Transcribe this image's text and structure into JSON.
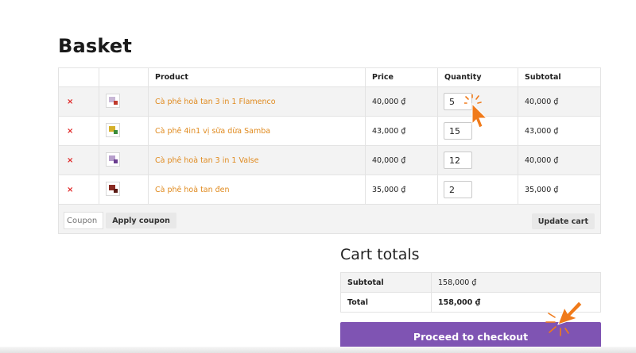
{
  "page": {
    "title": "Basket"
  },
  "table": {
    "headers": {
      "remove": "",
      "thumbnail": "",
      "product": "Product",
      "price": "Price",
      "quantity": "Quantity",
      "subtotal": "Subtotal"
    },
    "rows": [
      {
        "remove": "×",
        "product": "Cà phê hoà tan 3 in 1 Flamenco",
        "price": "40,000 ₫",
        "quantity": "5",
        "subtotal": "40,000 ₫",
        "thumb_colors": [
          "#c9b8d6",
          "#c0392b"
        ]
      },
      {
        "remove": "×",
        "product": "Cà phê 4in1 vị sữa dừa Samba",
        "price": "43,000 ₫",
        "quantity": "15",
        "subtotal": "43,000 ₫",
        "thumb_colors": [
          "#d4b02a",
          "#3a8c3a"
        ]
      },
      {
        "remove": "×",
        "product": "Cà phê hoà tan 3 in 1 Valse",
        "price": "40,000 ₫",
        "quantity": "12",
        "subtotal": "40,000 ₫",
        "thumb_colors": [
          "#b79fcc",
          "#6a3d8f"
        ]
      },
      {
        "remove": "×",
        "product": "Cà phê hoà tan đen",
        "price": "35,000 ₫",
        "quantity": "2",
        "subtotal": "35,000 ₫",
        "thumb_colors": [
          "#8a2b22",
          "#5a1a14"
        ]
      }
    ]
  },
  "actions": {
    "coupon_placeholder": "Coupon",
    "apply_coupon": "Apply coupon",
    "update_cart": "Update cart"
  },
  "totals": {
    "title": "Cart totals",
    "subtotal_label": "Subtotal",
    "subtotal_value": "158,000 ₫",
    "total_label": "Total",
    "total_value": "158,000 ₫"
  },
  "checkout": {
    "label": "Proceed to checkout"
  },
  "colors": {
    "accent": "#7f54b3",
    "link": "#e08a1e",
    "remove": "#e02424",
    "cursor": "#f07a1a"
  },
  "icons": {
    "remove": "remove-icon",
    "cursor": "pointer-cursor-icon"
  }
}
